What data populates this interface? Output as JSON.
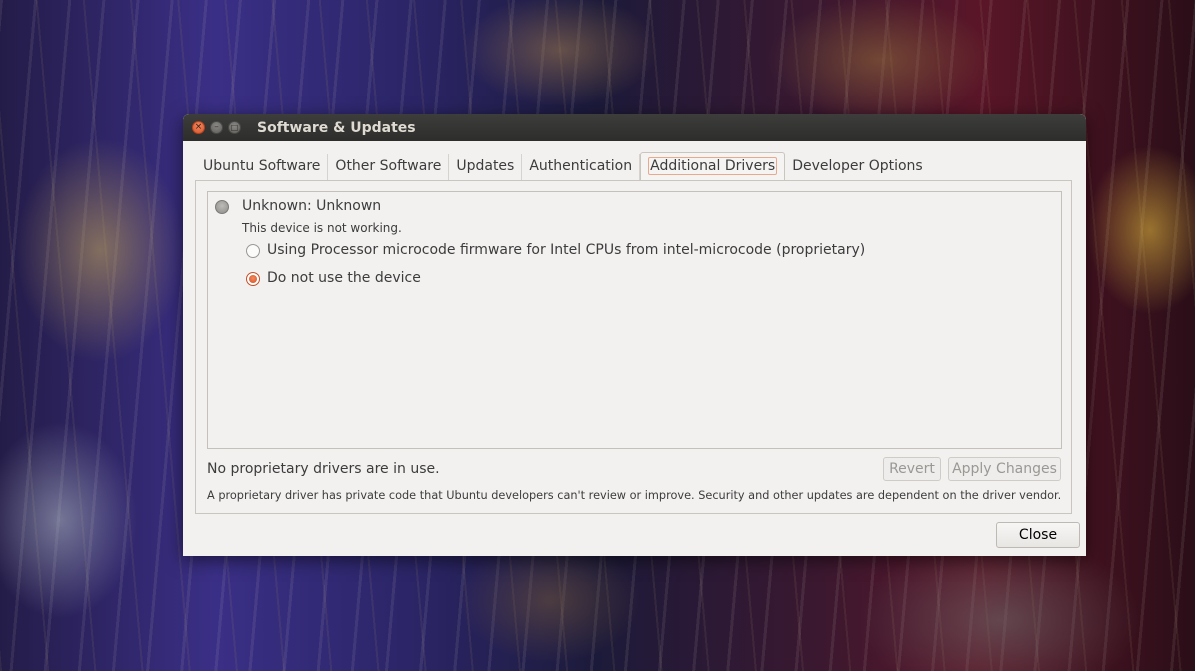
{
  "window": {
    "title": "Software & Updates",
    "controls": {
      "close": "×",
      "minimize": "–",
      "maximize": "□"
    }
  },
  "tabs": [
    {
      "label": "Ubuntu Software",
      "active": false
    },
    {
      "label": "Other Software",
      "active": false
    },
    {
      "label": "Updates",
      "active": false
    },
    {
      "label": "Authentication",
      "active": false
    },
    {
      "label": "Additional Drivers",
      "active": true
    },
    {
      "label": "Developer Options",
      "active": false
    }
  ],
  "device": {
    "name": "Unknown: Unknown",
    "status": "This device is not working.",
    "options": [
      {
        "label": "Using Processor microcode firmware for Intel CPUs from intel-microcode (proprietary)",
        "selected": false
      },
      {
        "label": "Do not use the device",
        "selected": true
      }
    ]
  },
  "footer": {
    "status": "No proprietary drivers are in use.",
    "note": "A proprietary driver has private code that Ubuntu developers can't review or improve. Security and other updates are dependent on the driver vendor.",
    "revert_label": "Revert",
    "apply_label": "Apply Changes"
  },
  "close_label": "Close",
  "colors": {
    "accent": "#dd4814",
    "titlebar": "#3c3b37",
    "window_bg": "#f2f1f0"
  }
}
